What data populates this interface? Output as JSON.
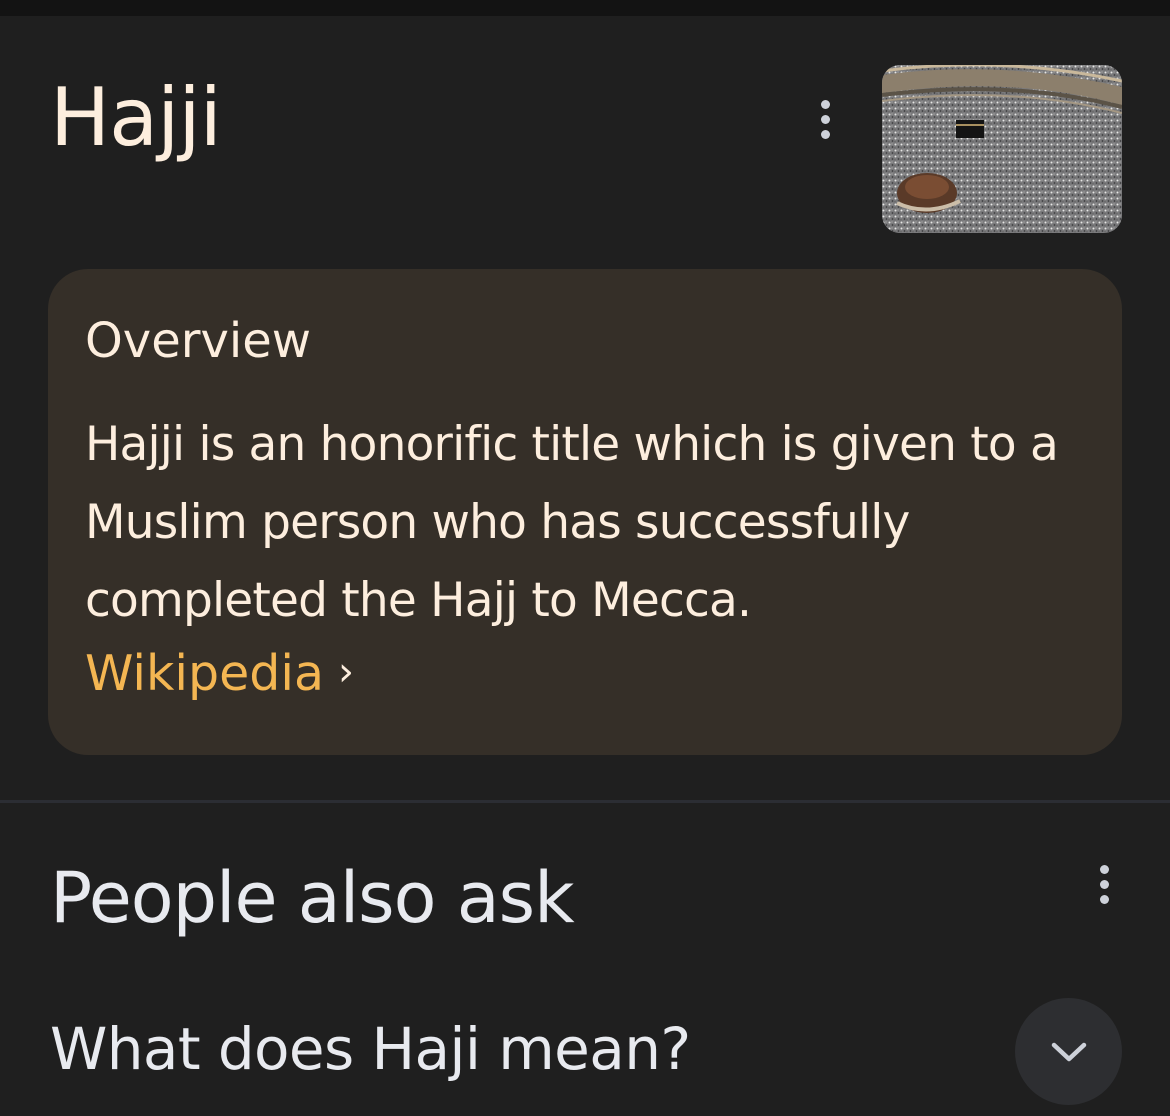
{
  "entity": {
    "title": "Hajji",
    "thumbnail_icon": "kaaba-photo"
  },
  "overview": {
    "heading": "Overview",
    "description": "Hajji is an honorific title which is given to a Muslim person who has successfully completed the Hajj to Mecca.",
    "source_link": "Wikipedia",
    "source_chevron": "›"
  },
  "people_also_ask": {
    "heading": "People also ask",
    "questions": [
      {
        "text": "What does Haji mean?"
      }
    ]
  },
  "colors": {
    "background": "#1f1f1f",
    "card": "#352f28",
    "title_text": "#fdeede",
    "link": "#f4b652",
    "paa_text": "#e8eaef"
  },
  "icons": {
    "menu": "more-vert-icon",
    "expand": "chevron-down-icon"
  }
}
